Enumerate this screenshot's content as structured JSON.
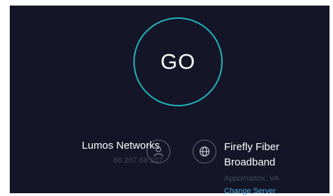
{
  "go_button": {
    "label": "GO"
  },
  "isp": {
    "name": "Lumos Networks",
    "ip": "66.207.68.107",
    "icon": "user-icon"
  },
  "server": {
    "name": "Firefly Fiber Broadband",
    "location": "Appomattox, VA",
    "change_label": "Change Server",
    "icon": "globe-icon"
  },
  "colors": {
    "background": "#141526",
    "accent_ring": "#22b5bd",
    "link": "#4aa8e0",
    "muted_text": "#45485e"
  }
}
